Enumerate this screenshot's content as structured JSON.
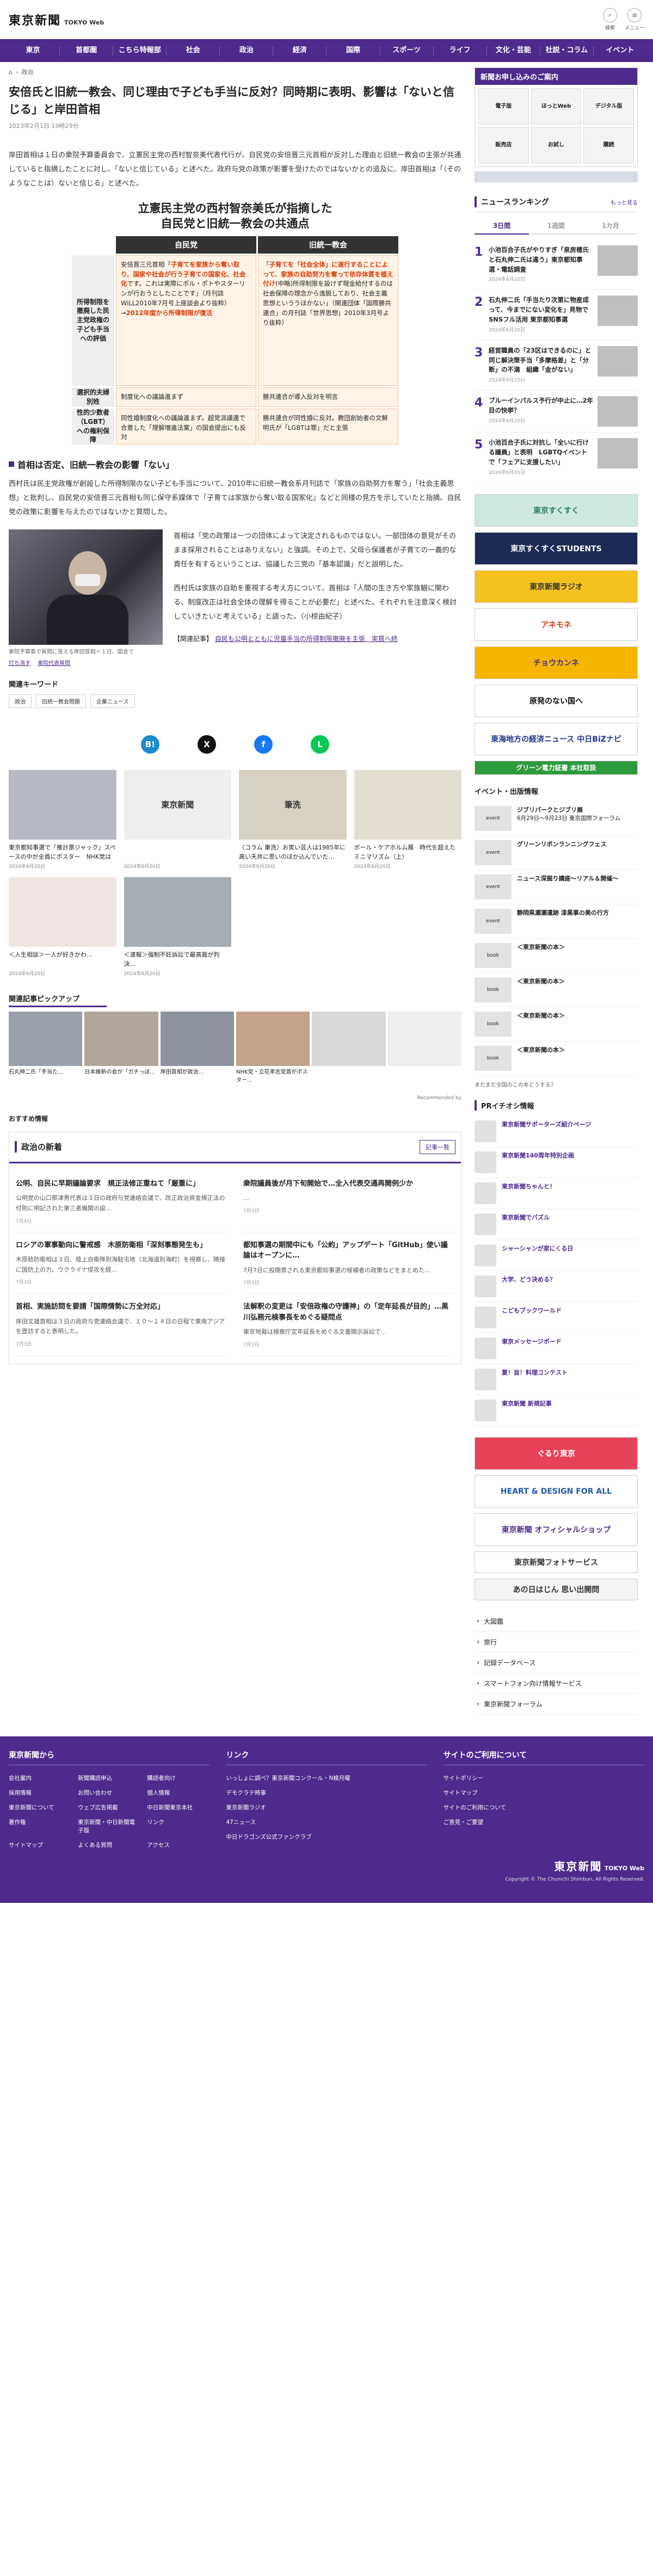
{
  "header": {
    "logo_jp": "東京新聞",
    "logo_en": "TOKYO Web",
    "search_label": "検索",
    "menu_label": "メニュー"
  },
  "nav": [
    "東京",
    "首都圏",
    "こちら特報部",
    "社会",
    "政治",
    "経済",
    "国際",
    "スポーツ",
    "ライフ",
    "文化・芸能",
    "社説・コラム",
    "イベント"
  ],
  "breadcrumb": {
    "home": "⌂",
    "section": "政治"
  },
  "article": {
    "title": "安倍氏と旧統一教会、同じ理由で子ども手当に反対？同時期に表明、影響は「ないと信じる」と岸田首相",
    "date": "2023年2月1日 19時29分",
    "lead": "岸田首相は１日の衆院予算委員会で、立憲民主党の西村智奈美代表代行が、自民党の安倍晋三元首相が反対した理由と旧統一教会の主張が共通していると指摘したことに対し、「ないと信じている」と述べた。政府与党の政策が影響を受けたのではないかとの追及に、岸田首相は「（そのようなことは）ないと信じる」と述べた。",
    "section_heading": "首相は否定、旧統一教会の影響「ない」",
    "para1": "西村氏は民主党政権が創設した所得制限のない子ども手当について、2010年に旧統一教会系月刊誌で「家族の自助努力を奪う」「社会主義思想」と批判し、自民党の安倍晋三元首相も同じ保守系媒体で「子育ては家族から奪い取る国家化」などと同様の見方を示していたと指摘。自民党の政策に影響を与えたのではないかと質問した。",
    "para2": "首相は「党の政策は一つの団体によって決定されるものではない。一部団体の意見がそのまま採用されることはありえない」と強調。その上で、父母ら保護者が子育ての一義的な責任を有するということは、協議した三党の「基本認識」だと説明した。",
    "para3": "西村氏は家族の自助を重視する考え方について、首相は「人間の生き方や家族観に関わる、制度改正は社会全体の理解を得ることが必要だ」と述べた。それぞれを注意深く検討していきたいと考えている」と語った。（小椋由紀子）",
    "related_label": "【関連記事】",
    "related_link": "自民も公明とともに児童手当の所得制限撤廃を主張　実質へ終",
    "photo_caption": "衆院予算委で質問に答える岸田首相＝１日、国会で",
    "photo_link_a": "打ち消す",
    "photo_link_b": "衆院代表質問"
  },
  "infographic": {
    "title_line1": "立憲民主党の西村智奈美氏が指摘した",
    "title_line2": "自民党と旧統一教会の共通点",
    "col_left": "自民党",
    "col_right": "旧統一教会",
    "row1_label": "所得制限を撤廃した民主党政権の子ども手当への評価",
    "row1_left_a": "安倍晋三元首相「",
    "row1_left_b": "子育てを家族から奪い取り、国家や社会が行う子育ての国家化、社会化",
    "row1_left_c": "です。これは実際にポル・ポトやスターリンが行おうとしたことです」（月刊誌WiLL2010年7月号上座談会より抜粋）→",
    "row1_left_d": "2012年度から所得制限が復活",
    "row1_right_a": "「",
    "row1_right_b": "子育てを「社会全体」に遂行することによって、家族の自助努力を奪って依存体質を植え付け",
    "row1_right_c": "(中略)所得制限を設けず現金給付するのは社会保障の理念から逸脱しており、社会主義思想といううほかない」（関連団体「国際勝共連合」の月刊誌「世界思想」2010年3月号より抜粋）",
    "row2_label": "選択的夫婦別姓",
    "row2_left": "制度化への議論進まず",
    "row2_right": "勝共連合が導入反対を明言",
    "row3_label": "性的少数者（LGBT）への権利保障",
    "row3_left": "同性婚制度化への議論進まず。超党派議連で合意した「理解増進法案」の国会提出にも反対",
    "row3_right": "勝共連合が同性婚に反対。教団創始者の文鮮明氏が「LGBTは罪」だと主張"
  },
  "keywords": {
    "title": "関連キーワード",
    "tags": [
      "政治",
      "旧統一教会問題",
      "企業ニュース"
    ]
  },
  "share_icons": [
    "hatena-icon",
    "x-icon",
    "facebook-icon",
    "line-icon"
  ],
  "recommend_cards": [
    {
      "title": "東京都知事選で「推計票ジャック」スペースの中が全員にポスター　NHK党は何がしたい…",
      "date": "2024年6月20日"
    },
    {
      "title": "",
      "date": "2024年6月20日"
    },
    {
      "title": "〈コラム 筆洗〉お笑い芸人は1985年に高い天井に思いのほか込んでいた…",
      "date": "2024年6月20日"
    },
    {
      "title": "ボール・ケアホルム展　時代を超えたミニマリズム（上）",
      "date": "2024年6月20日"
    },
    {
      "title": "＜人生相談＞一人が好きかわ…",
      "date": "2024年6月20日"
    },
    {
      "title": "＜速報＞強制不妊訴訟で最高裁が判決…",
      "date": "2024年6月20日"
    }
  ],
  "pickup": {
    "title": "関連記事ピックアップ",
    "items": [
      "石丸伸二氏「手当た…",
      "日本維新の会が「ガチっぽ…",
      "岸田首相が政治…",
      "NHK党・立花孝志党首がポスター…",
      "",
      ""
    ],
    "recommended_by": "Recommended by"
  },
  "osusume": "おすすめ情報",
  "politics_news": {
    "title": "政治の新着",
    "more": "記事一覧",
    "items": [
      {
        "title": "公明、自民に早期議論要求　規正法修正重ねて「厳重に」",
        "body": "公明党の山口那津男代表は３日の政府与党連絡会議で、改正政治資金規正法の付則に明記された第三者機関の設…",
        "date": "7月4日"
      },
      {
        "title": "衆院議員後が月下旬開始で…全入代表交通再開例少か",
        "body": "…",
        "date": "7月3日"
      },
      {
        "title": "ロシアの軍事動向に警戒感　木原防衛相「深刻事態発生も」",
        "body": "木原稔防衛相は３日、陸上自衛隊別海駐屯地（北海道別海町）を視察し、隣接に国防上の力、ウクライナ侵攻を経…",
        "date": "7月3日"
      },
      {
        "title": "都知事選の期間中にも「公約」アップデート「GitHub」使い議論はオープンに…",
        "body": "7月7日に投開票される東京都知事選の候補者の政策などをまとめた…",
        "date": "7月3日"
      },
      {
        "title": "首相、実施訪問を要請「国際情勢に万全対応」",
        "body": "岸田文雄首相は３日の政府与党連絡会議で、１０〜１４日の日程で東南アジアを歴訪すると表明した。",
        "date": "7月3日"
      },
      {
        "title": "法解釈の変更は「安倍政権の守護神」の「定年延長が目的」…黒川弘務元検事長をめぐる疑問点",
        "body": "東京地裁は検察庁定年延長をめぐる文書開示訴訟で…",
        "date": "7月2日"
      }
    ]
  },
  "sidebar": {
    "ad_head": "新聞お申し込みのご案内",
    "ad_cells": [
      "電子版",
      "ほっとWeb",
      "デジタル版",
      "販売店",
      "お試し",
      "購読"
    ],
    "ranking": {
      "title": "ニュースランキング",
      "more": "もっと見る",
      "tabs": [
        "3日間",
        "1週間",
        "1カ月"
      ],
      "items": [
        {
          "num": "1",
          "title": "小池百合子氏がやりすぎ「泉房穂氏と石丸伸二氏は違う」東京都知事選・電話調査",
          "date": "2024年6月20日"
        },
        {
          "num": "2",
          "title": "石丸伸二氏「手当たり次第に物産成って、今までにない変化を」見物で SNSフル活用 東京都知事選",
          "date": "2024年6月20日"
        },
        {
          "num": "3",
          "title": "経営職員の「23区はできるのに」と同じ解決策手当「多摩格差」と「分断」の不満　組織「金がない」",
          "date": "2024年6月20日"
        },
        {
          "num": "4",
          "title": "ブルーインパルス予行が中止に…2年目の快挙？",
          "date": "2024年6月20日"
        },
        {
          "num": "5",
          "title": "小池百合子氏に対抗し「全いに行ける議員」と表明　LGBTQイベントで「フェアに支援したい」",
          "date": "2024年6月20日"
        }
      ]
    },
    "banners": [
      "東京すくすく",
      "東京すくすくSTUDENTS",
      "東京新聞ラジオ",
      "アネモネ",
      "チョウカンネ",
      "原発のない国へ",
      "東海地方の経済ニュース 中日BiZナビ",
      "グリーン電力証書 本社取扱"
    ],
    "events_title": "イベント・出版情報",
    "events": [
      {
        "t": "ジブリパークとジブリ展",
        "d": "6月29日〜9月23日 東京国際フォーラム"
      },
      {
        "t": "グリーンリボンランニングフェス",
        "d": ""
      },
      {
        "t": "ニュース深掘り講座〜リアル＆開催〜",
        "d": ""
      },
      {
        "t": "静岡県瀬瀬遺跡 漆黒事の美の行方",
        "d": ""
      },
      {
        "t": "＜東京新聞の本＞",
        "d": ""
      },
      {
        "t": "＜東京新聞の本＞",
        "d": ""
      },
      {
        "t": "＜東京新聞の本＞",
        "d": ""
      },
      {
        "t": "＜東京新聞の本＞",
        "d": ""
      }
    ],
    "story_title": "まだまだ全国のこの本どうする？",
    "pr_title": "PRイチオシ情報",
    "pr": [
      {
        "t": "東京新聞サポーターズ紹介ページ",
        "d": ""
      },
      {
        "t": "東京新聞140周年特別企画",
        "d": ""
      },
      {
        "t": "東京新聞ちゃんと！",
        "d": ""
      },
      {
        "t": "東京新聞でパズル",
        "d": ""
      },
      {
        "t": "シャーシャンが家にくる日",
        "d": ""
      },
      {
        "t": "大学、どう決める？",
        "d": ""
      },
      {
        "t": "こどもブックワールド",
        "d": ""
      },
      {
        "t": "東京メッセージボード",
        "d": ""
      },
      {
        "t": "夏！旨！料理コンテスト",
        "d": ""
      },
      {
        "t": "東京新聞 新規記事",
        "d": ""
      }
    ],
    "banners2": [
      "ぐるり東京",
      "HEART & DESIGN FOR ALL",
      "東京新聞 オフィシャルショップ",
      "東京新聞フォトサービス",
      "あの日はじん 思い出開問"
    ],
    "links": [
      "大図鑑",
      "旅行",
      "記録データベース",
      "スマートフォン向け情報サービス",
      "東京新聞フォーラム"
    ]
  },
  "footer": {
    "col1_title": "東京新聞から",
    "col1_links": [
      "会社案内",
      "新聞購読申込",
      "購読者向け",
      "採用情報",
      "お問い合わせ",
      "個人情報",
      "東京新聞について",
      "ウェブ広告掲載",
      "中日新聞東京本社",
      "著作権",
      "東京新聞・中日新聞電子版",
      "リンク",
      "サイトマップ",
      "よくある質問",
      "アクセス"
    ],
    "col2_title": "リンク",
    "col2_links": [
      "いっしょに調べ？東京新聞コンクール・N検月曜",
      "デモクラテ時事",
      "東京新聞ラジオ",
      "47ニュース",
      "中日ドラゴンズ公式ファンクラブ"
    ],
    "col3_title": "サイトのご利用について",
    "col3_links": [
      "サイトポリシー",
      "サイトマップ",
      "サイトのご利用について",
      "ご意見・ご要望"
    ],
    "logo_jp": "東京新聞",
    "logo_en": "TOKYO Web",
    "copyright": "Copyright © The Chunichi Shimbun, All Rights Reserved."
  },
  "colors": {
    "brand": "#4d2a8c",
    "accent": "#d93a0b"
  }
}
